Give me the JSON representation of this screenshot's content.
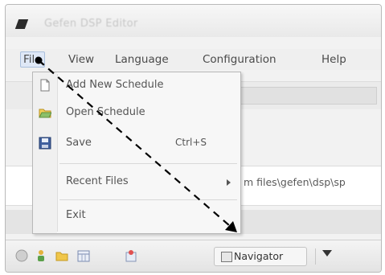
{
  "window": {
    "title": "Gefen DSP Editor"
  },
  "menubar": {
    "items": [
      {
        "label": "File"
      },
      {
        "label": "View"
      },
      {
        "label": "Language"
      },
      {
        "label": "Configuration"
      },
      {
        "label": "Help"
      }
    ]
  },
  "file_menu": {
    "items": [
      {
        "label": "Add New Schedule",
        "icon": "new-document-icon"
      },
      {
        "label": "Open Schedule",
        "icon": "open-folder-icon"
      },
      {
        "label": "Save",
        "shortcut": "Ctrl+S",
        "icon": "save-disk-icon"
      },
      {
        "label": "Recent Files",
        "has_submenu": true
      },
      {
        "label": "Exit"
      }
    ]
  },
  "path_bar": {
    "text": "m files\\gefen\\dsp\\sp"
  },
  "bottom_toolbar": {
    "navigator_label": "Navigator"
  },
  "annotation": {
    "arrow_color": "#000000"
  },
  "colors": {
    "menu_highlight": "#dfe8f6",
    "menu_bg": "#f7f7f7"
  }
}
